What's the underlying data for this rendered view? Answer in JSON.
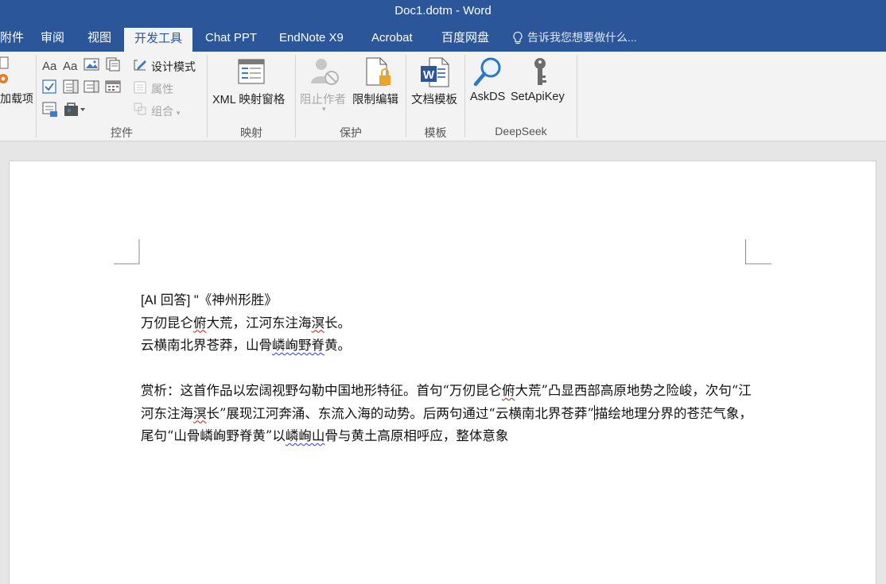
{
  "window": {
    "title": "Doc1.dotm - Word"
  },
  "tabs": [
    {
      "label": "附件",
      "active": false
    },
    {
      "label": "审阅",
      "active": false
    },
    {
      "label": "视图",
      "active": false
    },
    {
      "label": "开发工具",
      "active": true
    },
    {
      "label": "Chat PPT",
      "active": false
    },
    {
      "label": "EndNote X9",
      "active": false
    },
    {
      "label": "Acrobat",
      "active": false
    },
    {
      "label": "百度网盘",
      "active": false
    }
  ],
  "tell_me": {
    "placeholder": "告诉我您想要做什么..."
  },
  "ribbon": {
    "addins": {
      "label": "加载项"
    },
    "controls": {
      "group_label": "控件",
      "design_mode": "设计模式",
      "properties": "属性",
      "group": "组合"
    },
    "mapping": {
      "group_label": "映射",
      "xml_pane": "XML 映射窗格"
    },
    "protect": {
      "group_label": "保护",
      "block_authors": "阻止作者",
      "restrict_editing": "限制编辑"
    },
    "templates": {
      "group_label": "模板",
      "document_template": "文档模板"
    },
    "deepseek": {
      "group_label": "DeepSeek",
      "askds": "AskDS",
      "setapikey": "SetApiKey"
    }
  },
  "icons": {
    "addins": "gear-icon",
    "font_aa": "aa-text-icon",
    "picture": "picture-icon",
    "building_block": "building-block-icon",
    "checkbox": "checkbox-icon",
    "combo": "combo-box-icon",
    "dropdown": "dropdown-list-icon",
    "date": "date-picker-icon",
    "repeating": "repeating-section-icon",
    "legacy": "legacy-tools-icon",
    "design_mode": "design-mode-icon",
    "properties": "properties-icon",
    "group": "group-icon",
    "xml": "xml-pane-icon",
    "block": "block-authors-icon",
    "restrict": "restrict-editing-icon",
    "word_template": "word-template-icon",
    "askds": "magnifier-icon",
    "setapikey": "key-icon",
    "tell_me": "lightbulb-icon"
  },
  "colors": {
    "accent": "#2b579a",
    "ribbon_bg": "#f3f3f3",
    "spell_error": "#d21414",
    "grammar": "#2a3fd1"
  },
  "document": {
    "title_line": "[AI 回答] \"《神州形胜》",
    "line1_a": "万仞昆仑",
    "line1_b": "俯",
    "line1_c": "大荒，江河东注海",
    "line1_d": "溟",
    "line1_e": "长。",
    "line2_a": "云横南北界苍莽，山骨",
    "line2_b": "嶙峋野脊",
    "line2_c": "黄。",
    "analysis_a": "赏析：这首作品以宏阔视野勾勒中国地形特征。首句“万仞昆仑",
    "analysis_b": "俯",
    "analysis_c": "大荒”凸显西部高原地势之险峻，次句“江河东注海",
    "analysis_d": "溟",
    "analysis_e": "长”展现江河奔涌、东流入海的动势。后两句通过“云横南北界苍莽”",
    "analysis_f": "描绘地理分界的苍茫气象，尾句“山骨嶙峋野脊黄”以",
    "analysis_g": "嶙峋山",
    "analysis_h": "骨与黄土高原相呼应，整体意象"
  }
}
